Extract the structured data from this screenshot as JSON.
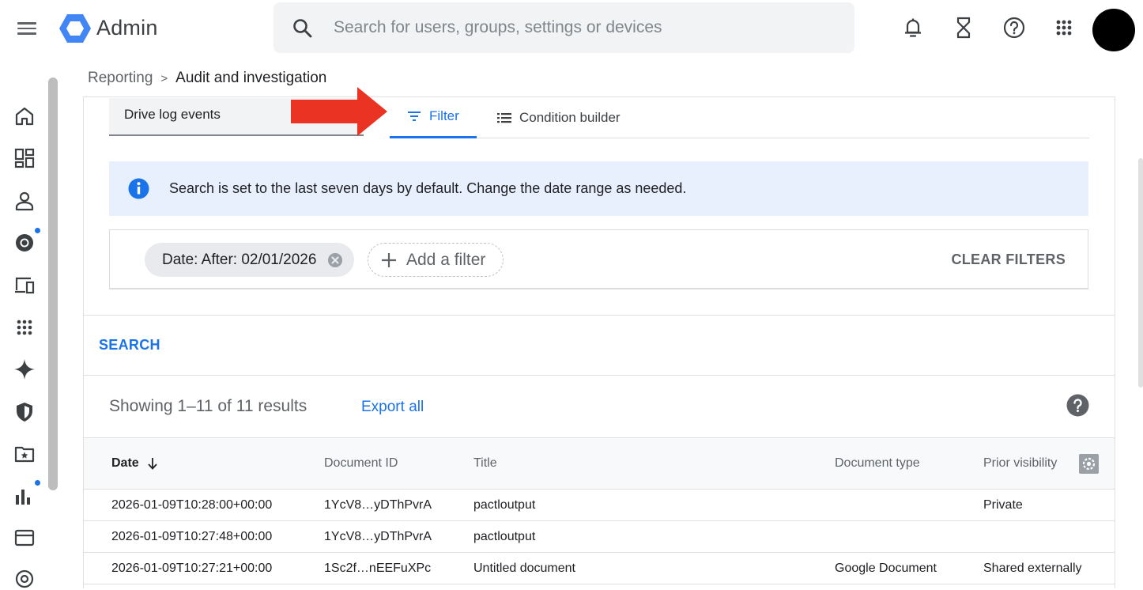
{
  "app": {
    "name": "Admin"
  },
  "search": {
    "placeholder": "Search for users, groups, settings or devices"
  },
  "breadcrumb": {
    "parent": "Reporting",
    "separator": ">",
    "current": "Audit and investigation"
  },
  "source_select": {
    "value": "Drive log events"
  },
  "tabs": [
    {
      "label": "Filter"
    },
    {
      "label": "Condition builder"
    }
  ],
  "banner": {
    "message": "Search is set to the last seven days by default. Change the date range as needed."
  },
  "filters": {
    "chip": "Date: After: 02/01/2026",
    "add_label": "Add a filter",
    "clear_label": "CLEAR FILTERS"
  },
  "search_button": "SEARCH",
  "results": {
    "count_text": "Showing 1–11 of 11 results",
    "export_label": "Export all"
  },
  "table": {
    "columns": [
      "Date",
      "Document ID",
      "Title",
      "Document type",
      "Prior visibility"
    ],
    "rows": [
      [
        "2026-01-09T10:28:00+00:00",
        "1YcV8…yDThPvrA",
        "pactloutput",
        "",
        "Private"
      ],
      [
        "2026-01-09T10:27:48+00:00",
        "1YcV8…yDThPvrA",
        "pactloutput",
        "",
        ""
      ],
      [
        "2026-01-09T10:27:21+00:00",
        "1Sc2f…nEEFuXPc",
        "Untitled document",
        "Google Document",
        "Shared externally"
      ]
    ]
  },
  "colors": {
    "accent": "#1a73e8",
    "arrow": "#ea3323",
    "banner_bg": "#e8f0fe"
  },
  "icons": {
    "top": [
      "notifications-bell-icon",
      "hourglass-icon",
      "help-icon",
      "apps-grid-icon"
    ],
    "rail": [
      "home-icon",
      "dashboard-icon",
      "users-icon",
      "chrome-icon",
      "devices-icon",
      "apps-icon",
      "gemini-icon",
      "security-icon",
      "drive-folder-icon",
      "reporting-icon",
      "billing-icon",
      "account-icon"
    ]
  }
}
